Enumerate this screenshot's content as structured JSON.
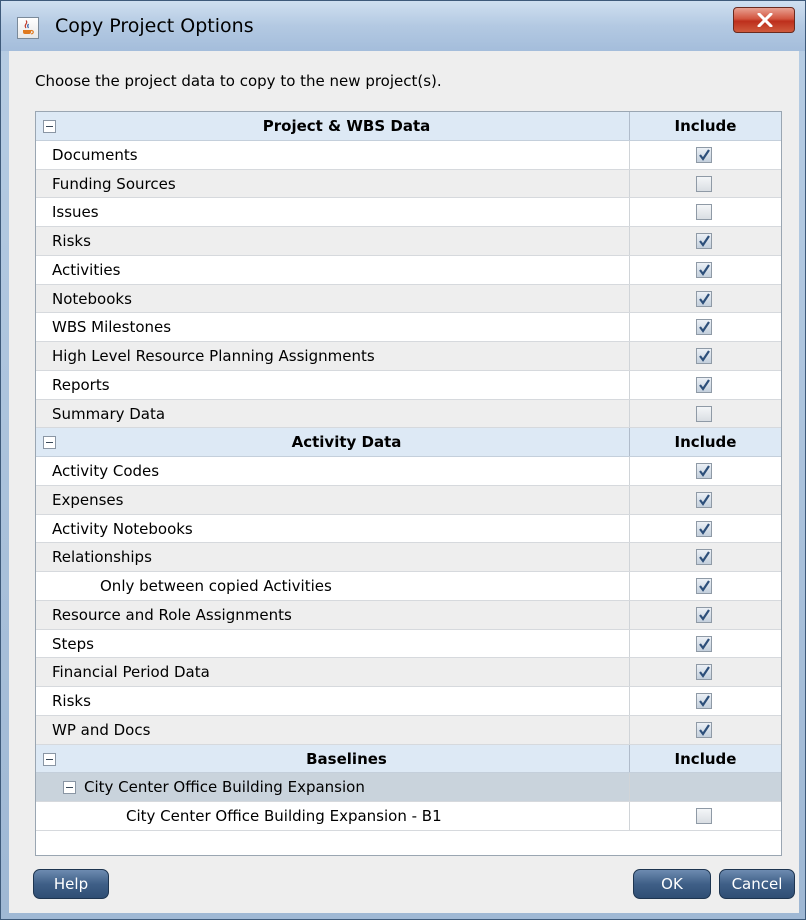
{
  "window": {
    "title": "Copy Project Options",
    "app_icon": "java-cup-icon",
    "close_icon": "close-x-icon"
  },
  "instructions": "Choose the project data to copy to the new project(s).",
  "sections": [
    {
      "title": "Project & WBS Data",
      "include_label": "Include",
      "rows": [
        {
          "label": "Documents",
          "checked": true,
          "indent": 0
        },
        {
          "label": "Funding Sources",
          "checked": false,
          "indent": 0
        },
        {
          "label": "Issues",
          "checked": false,
          "indent": 0
        },
        {
          "label": "Risks",
          "checked": true,
          "indent": 0
        },
        {
          "label": "Activities",
          "checked": true,
          "indent": 0
        },
        {
          "label": "Notebooks",
          "checked": true,
          "indent": 0
        },
        {
          "label": "WBS Milestones",
          "checked": true,
          "indent": 0
        },
        {
          "label": "High Level Resource Planning Assignments",
          "checked": true,
          "indent": 0
        },
        {
          "label": "Reports",
          "checked": true,
          "indent": 0
        },
        {
          "label": "Summary Data",
          "checked": false,
          "indent": 0
        }
      ]
    },
    {
      "title": "Activity Data",
      "include_label": "Include",
      "rows": [
        {
          "label": "Activity Codes",
          "checked": true,
          "indent": 0
        },
        {
          "label": "Expenses",
          "checked": true,
          "indent": 0
        },
        {
          "label": "Activity Notebooks",
          "checked": true,
          "indent": 0
        },
        {
          "label": "Relationships",
          "checked": true,
          "indent": 0
        },
        {
          "label": "Only between copied Activities",
          "checked": true,
          "indent": 1
        },
        {
          "label": "Resource and Role Assignments",
          "checked": true,
          "indent": 0
        },
        {
          "label": "Steps",
          "checked": true,
          "indent": 0
        },
        {
          "label": "Financial Period Data",
          "checked": true,
          "indent": 0
        },
        {
          "label": "Risks",
          "checked": true,
          "indent": 0
        },
        {
          "label": "WP and Docs",
          "checked": true,
          "indent": 0
        }
      ]
    },
    {
      "title": "Baselines",
      "include_label": "Include",
      "groups": [
        {
          "label": "City Center Office Building Expansion",
          "rows": [
            {
              "label": "City Center Office Building Expansion - B1",
              "checked": false,
              "indent": 1
            }
          ]
        }
      ]
    }
  ],
  "buttons": {
    "help": "Help",
    "ok": "OK",
    "cancel": "Cancel"
  }
}
